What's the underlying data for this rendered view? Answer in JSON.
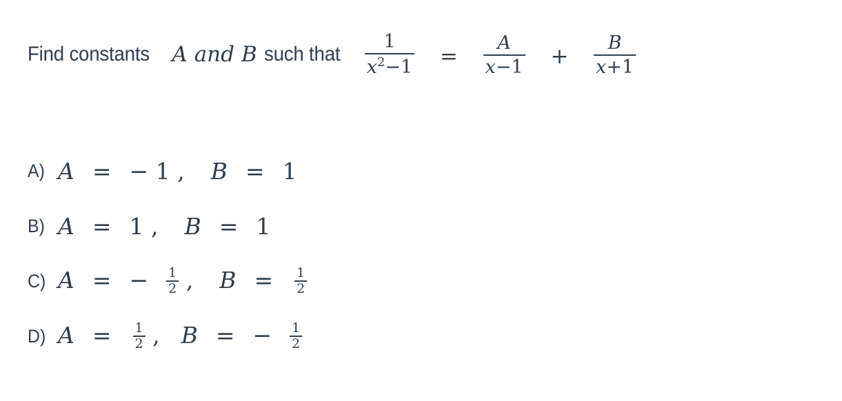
{
  "page": {
    "background_color": "#ffffff",
    "text_color": "#2d3e4f"
  },
  "question": {
    "prefix": "Find constants",
    "variable_a": "A",
    "conjunction": "and",
    "variable_b": "B",
    "suffix": "such that",
    "equation": {
      "latex": "\\frac{1}{x^2-1} = \\frac{A}{x-1} + \\frac{B}{x+1}",
      "plain": "1/(x^2-1) = A/(x-1) + B/(x+1)",
      "left": {
        "numerator": "1",
        "denominator_base": "x",
        "denominator_exponent": "2",
        "denominator_operator": "−",
        "denominator_constant": "1"
      },
      "relation": "=",
      "term1": {
        "numerator": "A",
        "denominator_base": "x",
        "denominator_operator": "−",
        "denominator_constant": "1"
      },
      "operator": "+",
      "term2": {
        "numerator": "B",
        "denominator_base": "x",
        "denominator_operator": "+",
        "denominator_constant": "1"
      }
    }
  },
  "options": [
    {
      "label": "A)",
      "plain": "A = -1,  B = 1",
      "a_symbol": "A",
      "a_equals": "=",
      "a_sign": "−",
      "a_value": "1",
      "comma": ",",
      "b_symbol": "B",
      "b_equals": "=",
      "b_value": "1"
    },
    {
      "label": "B)",
      "plain": "A = 1,  B = 1",
      "a_symbol": "A",
      "a_equals": "=",
      "a_value": "1",
      "comma": ",",
      "b_symbol": "B",
      "b_equals": "=",
      "b_value": "1"
    },
    {
      "label": "C)",
      "plain": "A = -1/2,  B = 1/2",
      "a_symbol": "A",
      "a_equals": "=",
      "a_sign": "−",
      "a_numerator": "1",
      "a_denominator": "2",
      "comma": ",",
      "b_symbol": "B",
      "b_equals": "=",
      "b_numerator": "1",
      "b_denominator": "2"
    },
    {
      "label": "D)",
      "plain": "A = 1/2, B = -1/2",
      "a_symbol": "A",
      "a_equals": "=",
      "a_numerator": "1",
      "a_denominator": "2",
      "comma": ",",
      "b_symbol": "B",
      "b_equals": "=",
      "b_sign": "−",
      "b_numerator": "1",
      "b_denominator": "2"
    }
  ]
}
